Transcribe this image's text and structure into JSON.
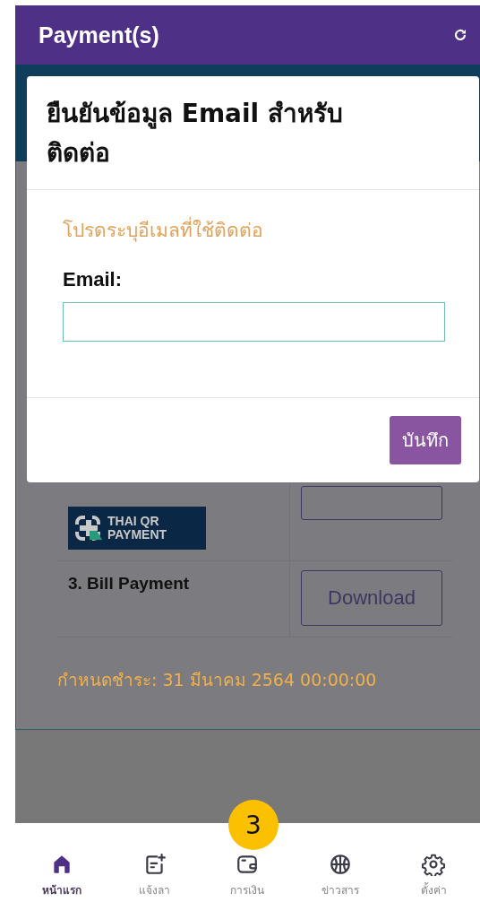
{
  "header": {
    "title": "Payment(s)"
  },
  "page": {
    "qr_logo": {
      "line_1": "THAI QR",
      "line_2": "PAYMENT"
    },
    "bill_row": {
      "label": "3. Bill Payment",
      "button": "Download"
    },
    "due": "กำหนดชำระ: 31 มีนาคม 2564 00:00:00"
  },
  "dialog": {
    "title": "ยืนยันข้อมูล Email สำหรับติดต่อ",
    "hint": "โปรดระบุอีเมลที่ใช้ติดต่อ",
    "field_label": "Email:",
    "save": "บันทึก"
  },
  "nav": {
    "badge": "3",
    "items": [
      {
        "kind": "home",
        "label": "หน้าแรก",
        "selected": true
      },
      {
        "kind": "leave",
        "label": "แจ้งลา",
        "selected": false
      },
      {
        "kind": "wallet",
        "label": "การเงิน",
        "selected": false
      },
      {
        "kind": "news",
        "label": "ข่าวสาร",
        "selected": false
      },
      {
        "kind": "settings",
        "label": "ตั้งค่า",
        "selected": false
      }
    ]
  }
}
